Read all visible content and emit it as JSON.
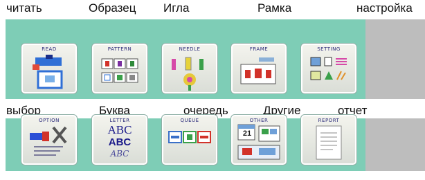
{
  "top_captions": [
    "читать",
    "Образец",
    "Игла",
    "Рамка",
    "настройка"
  ],
  "bottom_captions": [
    "выбор",
    "Буква",
    "очередь",
    "Другие",
    "отчет"
  ],
  "top_buttons": [
    {
      "label": "READ",
      "icon": "read-icon"
    },
    {
      "label": "PATTERN",
      "icon": "pattern-icon"
    },
    {
      "label": "NEEDLE",
      "icon": "needle-icon"
    },
    {
      "label": "FRAME",
      "icon": "frame-icon"
    },
    {
      "label": "SETTING",
      "icon": "setting-icon"
    }
  ],
  "bottom_buttons": [
    {
      "label": "OPTION",
      "icon": "option-icon"
    },
    {
      "label": "LETTER",
      "icon": "letter-icon",
      "glyphs": [
        "ABC",
        "ABC",
        "ABC"
      ]
    },
    {
      "label": "QUEUE",
      "icon": "queue-icon"
    },
    {
      "label": "OTHER",
      "icon": "other-icon",
      "number": "21"
    },
    {
      "label": "REPORT",
      "icon": "report-icon"
    }
  ],
  "colors": {
    "panel": "#7ecdb6",
    "side": "#bdbdbd",
    "button": "#eceee8"
  }
}
